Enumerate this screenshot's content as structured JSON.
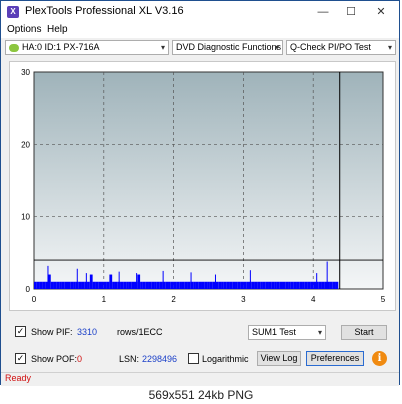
{
  "window": {
    "title": "PlexTools Professional XL V3.16",
    "minimize_glyph": "—",
    "maximize_glyph": "☐",
    "close_glyph": "✕"
  },
  "menu": {
    "options": "Options",
    "help": "Help"
  },
  "toolbar": {
    "drive": "HA:0 ID:1  PX-716A",
    "function": "DVD Diagnostic Functions",
    "test": "Q-Check PI/PO Test"
  },
  "chart_data": {
    "type": "bar",
    "x_range": [
      0,
      5
    ],
    "y_range": [
      0,
      30
    ],
    "x_ticks": [
      "0",
      "1",
      "2",
      "3",
      "4",
      "5"
    ],
    "y_ticks": [
      "0",
      "10",
      "20",
      "30"
    ],
    "grid": true,
    "pie_threshold": 4,
    "test_end_x": 4.38,
    "series": [
      {
        "color": "#0000ff",
        "x": [
          0.02,
          0.06,
          0.1,
          0.14,
          0.18,
          0.22,
          0.26,
          0.3,
          0.34,
          0.38,
          0.42,
          0.46,
          0.5,
          0.54,
          0.58,
          0.62,
          0.66,
          0.7,
          0.74,
          0.78,
          0.82,
          0.86,
          0.9,
          0.94,
          0.98,
          1.02,
          1.06,
          1.1,
          1.14,
          1.18,
          1.22,
          1.26,
          1.3,
          1.34,
          1.38,
          1.42,
          1.46,
          1.5,
          1.54,
          1.58,
          1.62,
          1.66,
          1.7,
          1.74,
          1.78,
          1.82,
          1.86,
          1.9,
          1.94,
          1.98,
          2.02,
          2.06,
          2.1,
          2.14,
          2.18,
          2.22,
          2.26,
          2.3,
          2.34,
          2.38,
          2.42,
          2.46,
          2.5,
          2.54,
          2.58,
          2.62,
          2.66,
          2.7,
          2.74,
          2.78,
          2.82,
          2.86,
          2.9,
          2.94,
          2.98,
          3.02,
          3.06,
          3.1,
          3.14,
          3.18,
          3.22,
          3.26,
          3.3,
          3.34,
          3.38,
          3.42,
          3.46,
          3.5,
          3.54,
          3.58,
          3.62,
          3.66,
          3.7,
          3.74,
          3.78,
          3.82,
          3.86,
          3.9,
          3.94,
          3.98,
          4.02,
          4.06,
          4.1,
          4.14,
          4.18,
          4.22,
          4.26,
          4.3,
          4.34
        ],
        "values": [
          1,
          1,
          1,
          1,
          1,
          2,
          1,
          1,
          1,
          1,
          1,
          1,
          1,
          1,
          1,
          1,
          1,
          1,
          1,
          1,
          2,
          1,
          1,
          1,
          1,
          1,
          1,
          2,
          1,
          1,
          1,
          1,
          1,
          1,
          1,
          1,
          1,
          2,
          1,
          1,
          1,
          1,
          1,
          1,
          1,
          1,
          1,
          1,
          1,
          1,
          1,
          1,
          1,
          1,
          1,
          1,
          1,
          1,
          1,
          1,
          1,
          1,
          1,
          1,
          1,
          1,
          1,
          1,
          1,
          1,
          1,
          1,
          1,
          1,
          1,
          1,
          1,
          1,
          1,
          1,
          1,
          1,
          1,
          1,
          1,
          1,
          1,
          1,
          1,
          1,
          1,
          1,
          1,
          1,
          1,
          1,
          1,
          1,
          1,
          1,
          1,
          1,
          1,
          1,
          1,
          1,
          1,
          1,
          1
        ],
        "spikes": [
          {
            "x": 0.2,
            "y": 3.2
          },
          {
            "x": 0.62,
            "y": 2.8
          },
          {
            "x": 0.75,
            "y": 2.2
          },
          {
            "x": 1.22,
            "y": 2.4
          },
          {
            "x": 1.47,
            "y": 2.2
          },
          {
            "x": 1.85,
            "y": 2.5
          },
          {
            "x": 2.25,
            "y": 2.3
          },
          {
            "x": 2.6,
            "y": 2.0
          },
          {
            "x": 3.1,
            "y": 2.6
          },
          {
            "x": 4.05,
            "y": 2.2
          },
          {
            "x": 4.2,
            "y": 3.8
          }
        ]
      }
    ]
  },
  "panel": {
    "show_pif_label": "Show PIF:",
    "pif_value": "3310",
    "rows_label": "rows/1ECC",
    "show_pof_label": "Show POF:",
    "pof_value": "0",
    "lsn_label": "LSN:",
    "lsn_value": "2298496",
    "logarithmic_label": "Logarithmic",
    "sum_test": "SUM1 Test",
    "start": "Start",
    "view_log": "View Log",
    "preferences": "Preferences",
    "info": "i",
    "check_glyph": "✓"
  },
  "status": {
    "text": "Ready"
  },
  "caption": "569x551  24kb  PNG"
}
